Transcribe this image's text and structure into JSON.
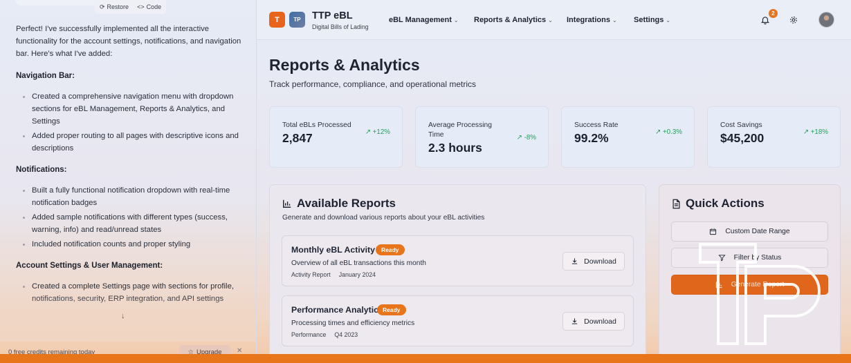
{
  "chat": {
    "actions": {
      "restore": "Restore",
      "code": "Code"
    },
    "intro": "Perfect! I've successfully implemented all the interactive functionality for the account settings, notifications, and navigation bar. Here's what I've added:",
    "sections": [
      {
        "title": "Navigation Bar:",
        "items": [
          "Created a comprehensive navigation menu with dropdown sections for eBL Management, Reports & Analytics, and Settings",
          "Added proper routing to all pages with descriptive icons and descriptions"
        ]
      },
      {
        "title": "Notifications:",
        "items": [
          "Built a fully functional notification dropdown with real-time notification badges",
          "Added sample notifications with different types (success, warning, info) and read/unread states",
          "Included notification counts and proper styling"
        ]
      },
      {
        "title": "Account Settings & User Management:",
        "items": [
          "Created a complete Settings page with sections for profile, notifications, security, ERP integration, and API settings"
        ]
      }
    ],
    "credits": "0 free credits remaining today",
    "upgrade": "Upgrade"
  },
  "app": {
    "logo_t": "T",
    "logo_tp": "TP",
    "brand": "TTP eBL",
    "brand_sub": "Digital Bills of Lading",
    "nav": [
      "eBL Management",
      "Reports & Analytics",
      "Integrations",
      "Settings"
    ],
    "notification_count": "2",
    "page_title": "Reports & Analytics",
    "page_subtitle": "Track performance, compliance, and operational metrics",
    "stats": [
      {
        "label": "Total eBLs Processed",
        "value": "2,847",
        "trend": "+12%"
      },
      {
        "label": "Average Processing Time",
        "value": "2.3 hours",
        "trend": "-8%"
      },
      {
        "label": "Success Rate",
        "value": "99.2%",
        "trend": "+0.3%"
      },
      {
        "label": "Cost Savings",
        "value": "$45,200",
        "trend": "+18%"
      }
    ],
    "reports": {
      "title": "Available Reports",
      "subtitle": "Generate and download various reports about your eBL activities",
      "items": [
        {
          "name": "Monthly eBL Activity",
          "status": "Ready",
          "desc": "Overview of all eBL transactions this month",
          "type": "Activity Report",
          "period": "January 2024",
          "action": "Download"
        },
        {
          "name": "Performance Analytics",
          "status": "Ready",
          "desc": "Processing times and efficiency metrics",
          "type": "Performance",
          "period": "Q4 2023",
          "action": "Download"
        }
      ]
    },
    "quick": {
      "title": "Quick Actions",
      "buttons": [
        "Custom Date Range",
        "Filter by Status",
        "Generate Report"
      ]
    }
  },
  "colors": {
    "accent": "#e8751a",
    "success": "#22a05a",
    "text": "#1f2433"
  }
}
